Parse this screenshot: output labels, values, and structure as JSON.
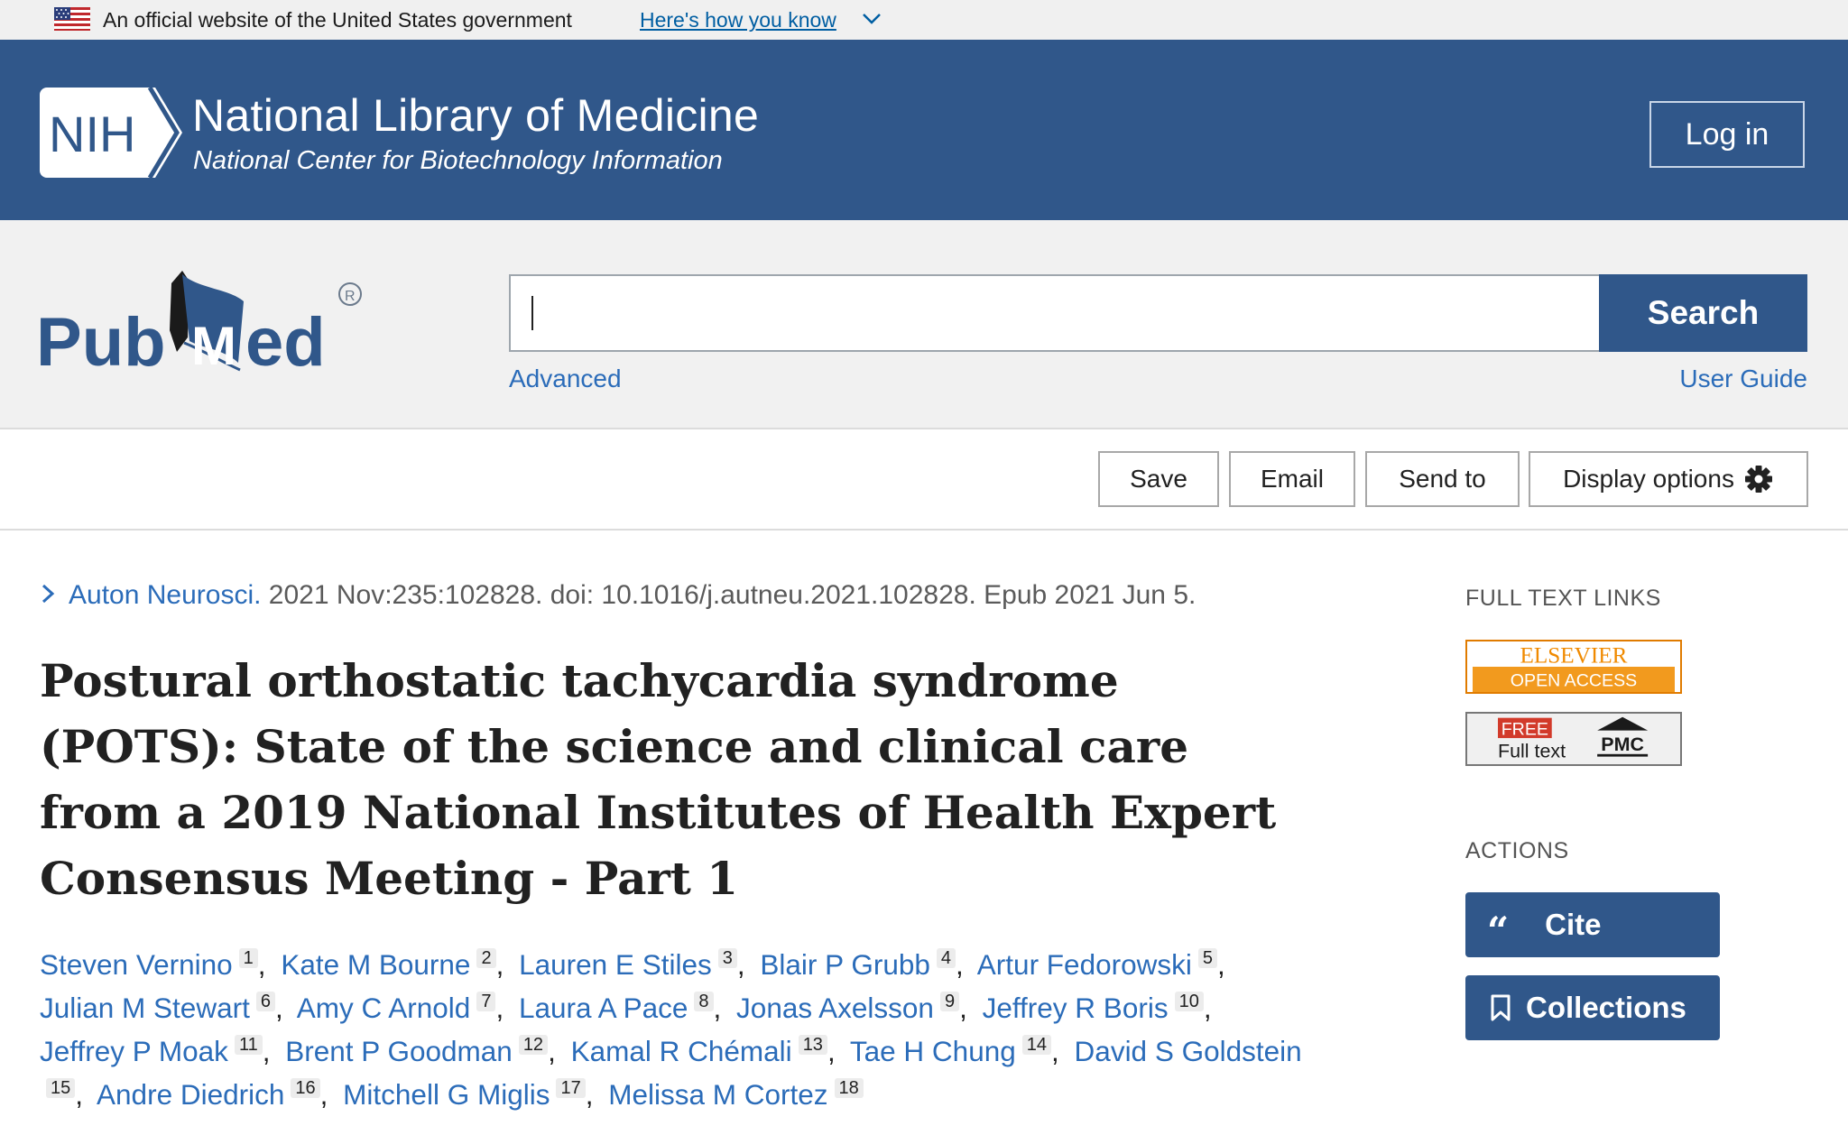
{
  "gov_banner": {
    "text": "An official website of the United States government",
    "link": "Here's how you know"
  },
  "header": {
    "logo_text": "NIH",
    "title": "National Library of Medicine",
    "subtitle": "National Center for Biotechnology Information",
    "login_label": "Log in"
  },
  "search": {
    "logo_text": "PubMed",
    "query": "",
    "button_label": "Search",
    "advanced_label": "Advanced",
    "guide_label": "User Guide"
  },
  "toolbar": {
    "save_label": "Save",
    "email_label": "Email",
    "send_label": "Send to",
    "display_label": "Display options"
  },
  "article": {
    "journal": "Auton Neurosci.",
    "citation": " 2021 Nov:235:102828. doi: 10.1016/j.autneu.2021.102828. Epub 2021 Jun 5.",
    "title": "Postural orthostatic tachycardia syndrome (POTS): State of the science and clinical care from a 2019 National Institutes of Health Expert Consensus Meeting - Part 1",
    "authors": [
      {
        "name": "Steven Vernino",
        "aff": "1"
      },
      {
        "name": "Kate M Bourne",
        "aff": "2"
      },
      {
        "name": "Lauren E Stiles",
        "aff": "3"
      },
      {
        "name": "Blair P Grubb",
        "aff": "4"
      },
      {
        "name": "Artur Fedorowski",
        "aff": "5"
      },
      {
        "name": "Julian M Stewart",
        "aff": "6"
      },
      {
        "name": "Amy C Arnold",
        "aff": "7"
      },
      {
        "name": "Laura A Pace",
        "aff": "8"
      },
      {
        "name": "Jonas Axelsson",
        "aff": "9"
      },
      {
        "name": "Jeffrey R Boris",
        "aff": "10"
      },
      {
        "name": "Jeffrey P Moak",
        "aff": "11"
      },
      {
        "name": "Brent P Goodman",
        "aff": "12"
      },
      {
        "name": "Kamal R Chémali",
        "aff": "13"
      },
      {
        "name": "Tae H Chung",
        "aff": "14"
      },
      {
        "name": "David S Goldstein",
        "aff": "15"
      },
      {
        "name": "Andre Diedrich",
        "aff": "16"
      },
      {
        "name": "Mitchell G Miglis",
        "aff": "17"
      },
      {
        "name": "Melissa M Cortez",
        "aff": "18"
      }
    ]
  },
  "sidebar": {
    "full_text_heading": "FULL TEXT LINKS",
    "elsevier_top": "ELSEVIER",
    "elsevier_bottom": "OPEN ACCESS",
    "pmc_free": "FREE",
    "pmc_full": "Full text",
    "pmc_label": "PMC",
    "actions_heading": "ACTIONS",
    "cite_label": "Cite",
    "collections_label": "Collections"
  },
  "colors": {
    "nih_blue": "#30578a",
    "link_blue": "#2b6cb9",
    "elsevier_orange": "#f29a1e"
  }
}
